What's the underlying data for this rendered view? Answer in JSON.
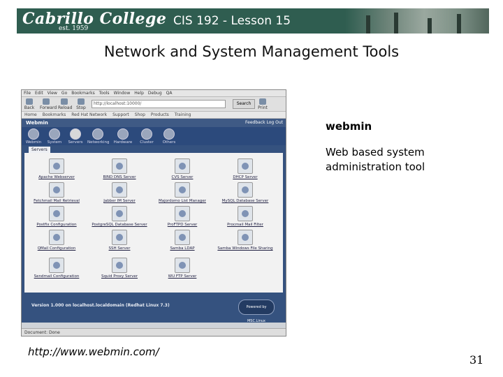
{
  "header": {
    "college_logo": "Cabrillo College",
    "established": "est. 1959",
    "course_title": "CIS 192 - Lesson 15"
  },
  "slide": {
    "title": "Network and System Management Tools",
    "side_label": "webmin",
    "side_description": "Web based system administration tool",
    "link": "http://www.webmin.com/",
    "page_number": "31"
  },
  "browser": {
    "menu": [
      "File",
      "Edit",
      "View",
      "Go",
      "Bookmarks",
      "Tools",
      "Window",
      "Help",
      "Debug",
      "QA"
    ],
    "toolbar": [
      "Back",
      "Forward",
      "Reload",
      "Stop"
    ],
    "url": "http://localhost:10000/",
    "search_label": "Search",
    "print_label": "Print",
    "bookmarks": [
      "Home",
      "Bookmarks",
      "Red Hat Network",
      "Support",
      "Shop",
      "Products",
      "Training"
    ],
    "status": "Document: Done"
  },
  "webmin": {
    "name": "Webmin",
    "top_links": "Feedback    Log Out",
    "categories": [
      "Webmin",
      "System",
      "Servers",
      "Networking",
      "Hardware",
      "Cluster",
      "Others"
    ],
    "active_tab": "Servers",
    "modules": [
      "Apache Webserver",
      "BIND DNS Server",
      "CVS Server",
      "DHCP Server",
      "Fetchmail Mail Retrieval",
      "Jabber IM Server",
      "Majordomo List Manager",
      "MySQL Database Server",
      "Postfix Configuration",
      "PostgreSQL Database Server",
      "ProFTPD Server",
      "Procmail Mail Filter",
      "QMail Configuration",
      "SSH Server",
      "Samba LDAP",
      "Samba Windows File Sharing",
      "Sendmail Configuration",
      "Squid Proxy Server",
      "WU FTP Server"
    ],
    "version": "Version 1.000 on localhost.localdomain (Redhat Linux 7.3)",
    "powered_by": "Powered by MSC.Linux"
  }
}
